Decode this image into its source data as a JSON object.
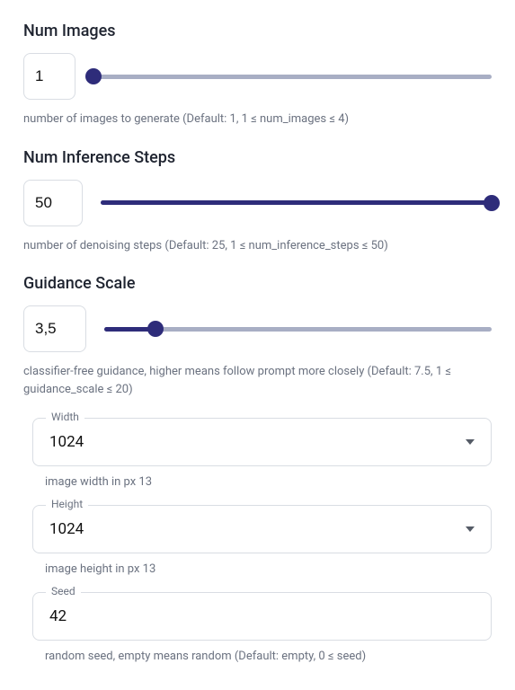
{
  "numImages": {
    "title": "Num Images",
    "value": "1",
    "min": 1,
    "max": 4,
    "current": 1,
    "desc": "number of images to generate (Default: 1, 1 ≤ num_images ≤ 4)"
  },
  "numSteps": {
    "title": "Num Inference Steps",
    "value": "50",
    "min": 1,
    "max": 50,
    "current": 50,
    "desc": "number of denoising steps (Default: 25, 1 ≤ num_inference_steps ≤ 50)"
  },
  "guidance": {
    "title": "Guidance Scale",
    "value": "3,5",
    "min": 1,
    "max": 20,
    "current": 3.5,
    "desc": "classifier-free guidance, higher means follow prompt more closely (Default: 7.5, 1 ≤ guidance_scale ≤ 20)"
  },
  "width": {
    "legend": "Width",
    "value": "1024",
    "desc": "image width in px 13"
  },
  "height": {
    "legend": "Height",
    "value": "1024",
    "desc": "image height in px 13"
  },
  "seed": {
    "legend": "Seed",
    "value": "42",
    "desc": "random seed, empty means random (Default: empty, 0 ≤ seed)"
  }
}
